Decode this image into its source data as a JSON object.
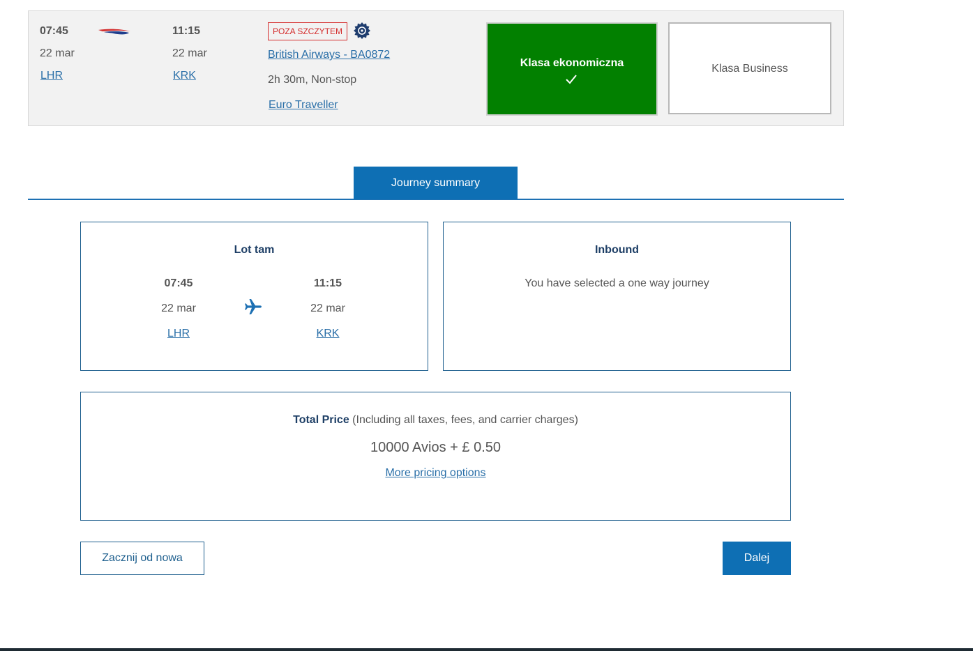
{
  "flight": {
    "depart_time": "07:45",
    "depart_date": "22 mar",
    "depart_airport": "LHR",
    "arrive_time": "11:15",
    "arrive_date": "22 mar",
    "arrive_airport": "KRK",
    "offpeak_badge": "POZA SZCZYTEM",
    "airline_flight": "British Airways - BA0872",
    "duration": "2h 30m, Non-stop",
    "fare_family": "Euro Traveller",
    "logo_icon": "british-airways-speedmarque-icon",
    "avios_icon": "avios-badge-icon"
  },
  "cabins": [
    {
      "label": "Klasa ekonomiczna",
      "selected": true,
      "color": "#028000"
    },
    {
      "label": "Klasa Business",
      "selected": false
    }
  ],
  "tabs": {
    "journey_summary": "Journey summary"
  },
  "summary": {
    "outbound_title": "Lot tam",
    "outbound": {
      "depart_time": "07:45",
      "depart_date": "22 mar",
      "depart_airport": "LHR",
      "arrive_time": "11:15",
      "arrive_date": "22 mar",
      "arrive_airport": "KRK"
    },
    "inbound_title": "Inbound",
    "inbound_message": "You have selected a one way journey"
  },
  "price": {
    "label": "Total Price",
    "note": " (Including all taxes, fees, and carrier charges)",
    "amount": "10000 Avios + £ 0.50",
    "more_link": "More pricing options"
  },
  "actions": {
    "restart": "Zacznij od nowa",
    "next": "Dalej"
  },
  "colors": {
    "accent": "#0e6fb4",
    "selected_green": "#028000",
    "badge_red": "#d42b2b",
    "link": "#2a6fa8"
  }
}
